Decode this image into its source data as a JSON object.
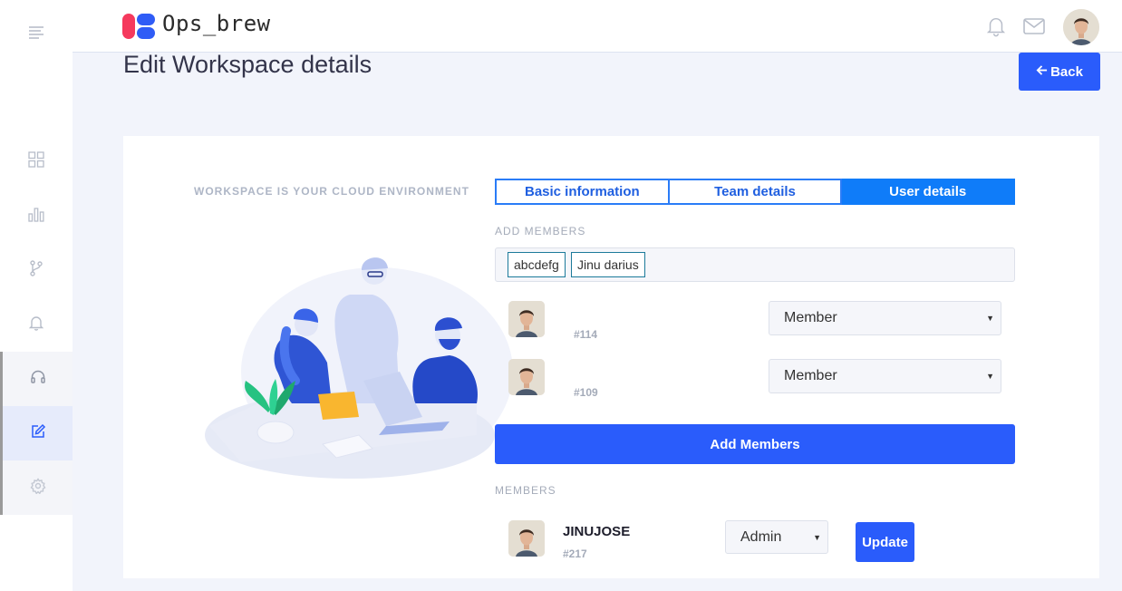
{
  "header": {
    "brand": "Ops_brew",
    "icons": [
      "bell-icon",
      "mail-icon"
    ],
    "avatar": "user-avatar"
  },
  "sidebar": {
    "items": [
      {
        "icon": "menu-icon"
      },
      {
        "icon": "grid-icon"
      },
      {
        "icon": "bar-chart-icon"
      },
      {
        "icon": "git-branch-icon"
      },
      {
        "icon": "bell-icon"
      },
      {
        "icon": "headset-icon"
      },
      {
        "icon": "edit-icon",
        "active": true
      },
      {
        "icon": "settings-icon"
      }
    ]
  },
  "page": {
    "title": "Edit Workspace details",
    "back_label": "Back"
  },
  "illustration": {
    "title": "WORKSPACE IS YOUR CLOUD ENVIRONMENT"
  },
  "tabs": [
    {
      "label": "Basic information",
      "active": false
    },
    {
      "label": "Team details",
      "active": false
    },
    {
      "label": "User details",
      "active": true
    }
  ],
  "add_members": {
    "label": "ADD MEMBERS",
    "tags": [
      "abcdefg",
      "Jinu darius"
    ],
    "rows": [
      {
        "id": "#114",
        "role": "Member"
      },
      {
        "id": "#109",
        "role": "Member"
      }
    ],
    "button_label": "Add Members"
  },
  "members": {
    "label": "MEMBERS",
    "rows": [
      {
        "name": "JINUJOSE",
        "id": "#217",
        "role": "Admin",
        "update_label": "Update"
      }
    ]
  },
  "colors": {
    "primary": "#2a5cfb",
    "tab_active": "#0f7cf9",
    "brand_red": "#f5395d",
    "brand_blue": "#2f5cf6"
  }
}
